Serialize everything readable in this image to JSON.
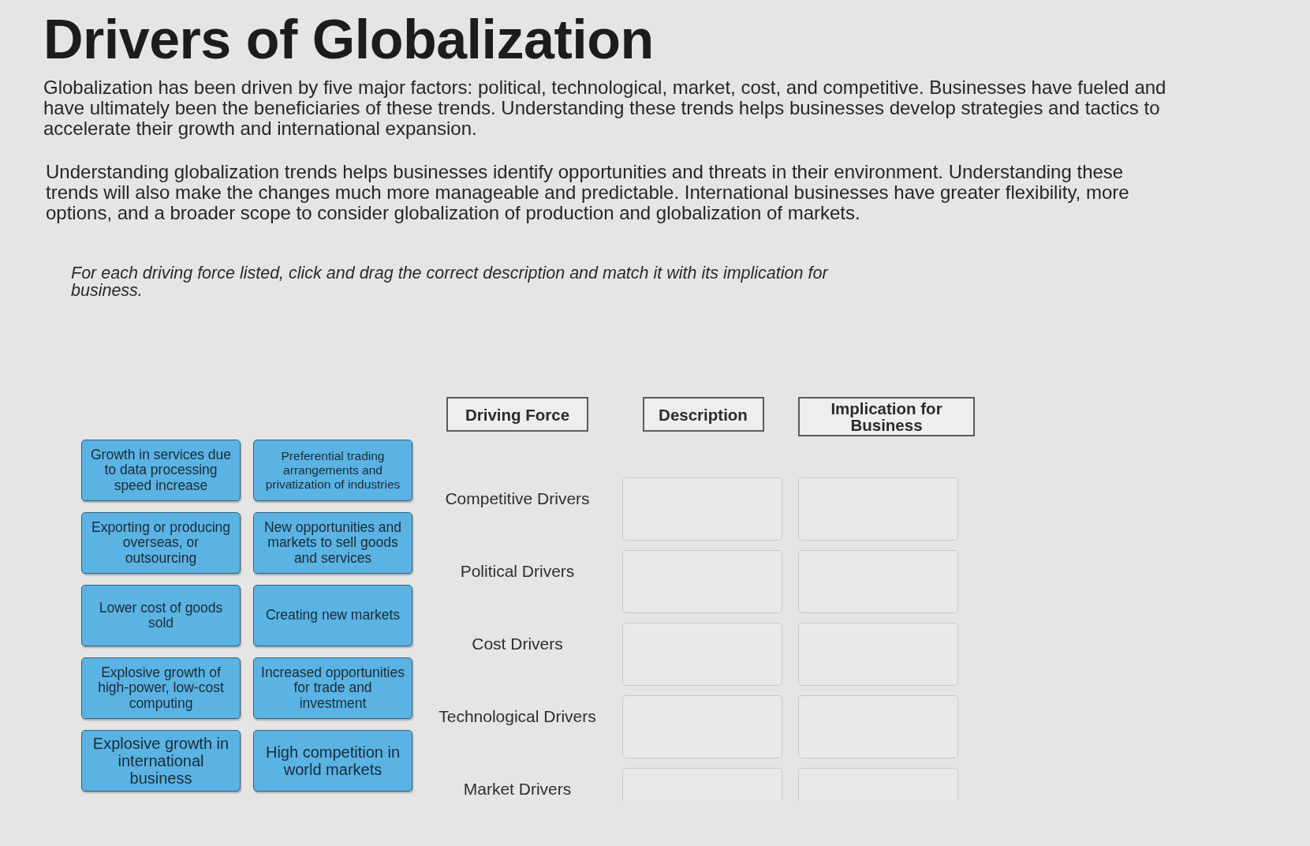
{
  "title": "Drivers of Globalization",
  "intro": [
    "Globalization has been driven by five major factors: political, technological, market, cost, and competitive. Businesses have fueled and have ultimately been the beneficiaries of these trends. Understanding these trends helps businesses develop strategies and tactics to accelerate their growth and international expansion.",
    "Understanding globalization trends helps businesses identify opportunities and threats in their environment. Understanding these trends will also make the changes much more manageable and predictable. International businesses have greater flexibility, more options, and a broader scope to consider globalization of production and globalization of markets."
  ],
  "instructions": "For each driving force listed, click and drag the correct description and match it with its implication for business.",
  "answer_cards": [
    "Growth in services due to data processing speed increase",
    "Preferential trading arrangements and privatization of industries",
    "Exporting or producing overseas, or outsourcing",
    "New opportunities and markets to sell goods and services",
    "Lower cost of goods sold",
    "Creating new markets",
    "Explosive growth of high-power, low-cost computing",
    "Increased opportunities for trade and investment",
    "Explosive growth in international business",
    "High competition in world markets"
  ],
  "matching_table": {
    "columns": [
      "Driving Force",
      "Description",
      "Implication for Business"
    ],
    "rows": [
      {
        "driving_force": "Competitive Drivers"
      },
      {
        "driving_force": "Political Drivers"
      },
      {
        "driving_force": "Cost Drivers"
      },
      {
        "driving_force": "Technological Drivers"
      },
      {
        "driving_force": "Market Drivers"
      }
    ]
  }
}
